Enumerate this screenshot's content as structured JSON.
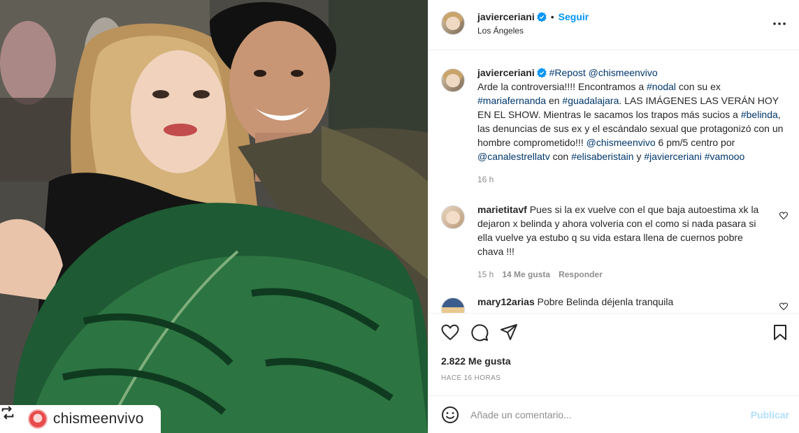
{
  "photo": {
    "repost_handle": "chismeenvivo"
  },
  "header": {
    "username": "javierceriani",
    "separator": "•",
    "follow_label": "Seguir",
    "location": "Los Ángeles"
  },
  "caption": {
    "username": "javierceriani",
    "parts": {
      "p1": "#Repost",
      "p2": "@chismeenvivo",
      "p3": "Arde la controversia!!!! Encontramos a ",
      "p4": "#nodal",
      "p5": " con su ex ",
      "p6": "#mariafernanda",
      "p7": " en ",
      "p8": "#guadalajara",
      "p9": ". LAS IMÁGENES LAS VERÁN HOY EN EL SHOW. Mientras le sacamos los trapos más sucios a ",
      "p10": "#belinda",
      "p11": ", las denuncias de sus ex y el escándalo sexual que protagonizó con un hombre comprometido!!! ",
      "p12": "@chismeenvivo",
      "p13": " 6 pm/5 centro por ",
      "p14": "@canalestrellatv",
      "p15": " con ",
      "p16": "#elisaberistain",
      "p17": " y ",
      "p18": "#javierceriani",
      "p19": " ",
      "p20": "#vamooo"
    },
    "time": "16 h"
  },
  "comments": [
    {
      "username": "marietitavf",
      "text": "Pues si la ex vuelve con el que baja autoestima xk la dejaron x belinda y ahora volveria con el como si nada pasara si ella vuelve ya estubo q su vida estara llena de cuernos pobre chava !!!",
      "time": "15 h",
      "likes": "14 Me gusta",
      "reply": "Responder"
    },
    {
      "username": "mary12arias",
      "text": "Pobre Belinda déjenla tranquila"
    }
  ],
  "actions": {
    "likes": "2.822 Me gusta",
    "timestamp": "HACE 16 HORAS"
  },
  "add_comment": {
    "placeholder": "Añade un comentario...",
    "publish_label": "Publicar"
  },
  "colors": {
    "link": "#0095f6",
    "hashtag": "#00376b",
    "muted": "#8e8e8e",
    "publish_disabled": "#b2dffc"
  },
  "icons": {
    "header_more": "more-horizontal-icon",
    "verified": "verified-badge-icon",
    "like": "heart-outline-icon",
    "comment": "comment-bubble-icon",
    "share": "paper-plane-icon",
    "save": "bookmark-icon",
    "emoji": "smiley-icon",
    "repost": "repost-icon"
  }
}
